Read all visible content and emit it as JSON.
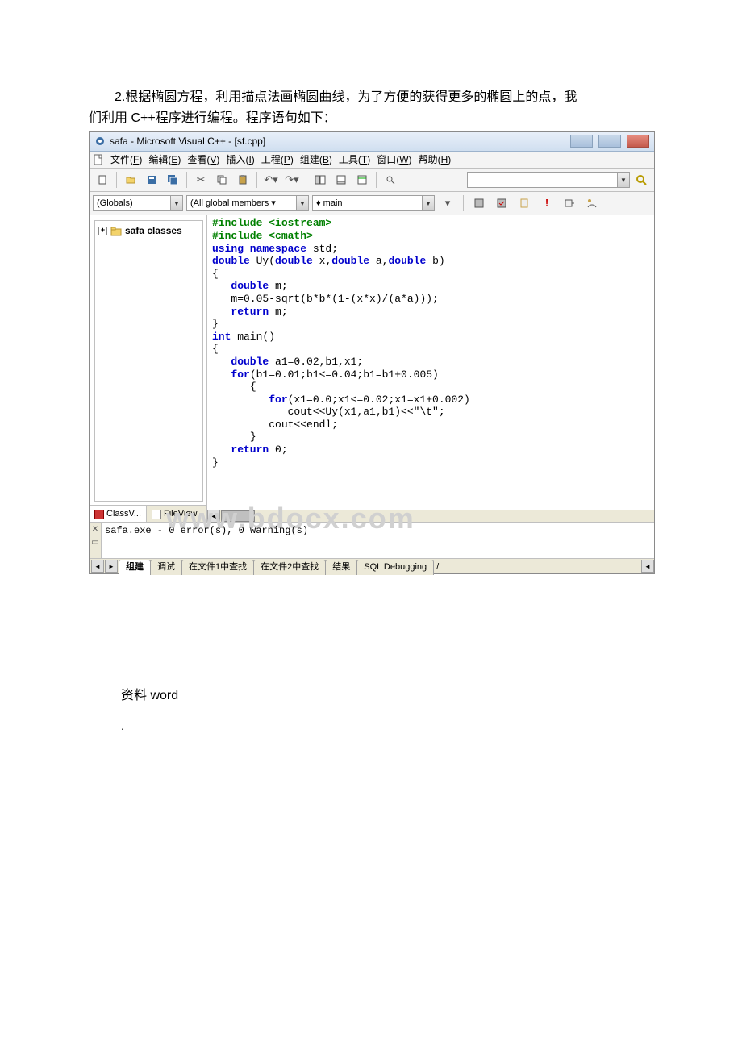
{
  "doc": {
    "intro1": "2.根据椭圆方程，利用描点法画椭圆曲线，为了方便的获得更多的椭圆上的点，我",
    "intro2": "们利用 C++程序进行编程。程序语句如下：",
    "footer1": "资料 word",
    "footer_dot": "."
  },
  "ide": {
    "title": "safa - Microsoft Visual C++ - [sf.cpp]",
    "menu": {
      "file": {
        "label": "文件",
        "accel": "F"
      },
      "edit": {
        "label": "编辑",
        "accel": "E"
      },
      "view": {
        "label": "查看",
        "accel": "V"
      },
      "insert": {
        "label": "插入",
        "accel": "I"
      },
      "project": {
        "label": "工程",
        "accel": "P"
      },
      "build": {
        "label": "组建",
        "accel": "B"
      },
      "tools": {
        "label": "工具",
        "accel": "T"
      },
      "window": {
        "label": "窗口",
        "accel": "W"
      },
      "help": {
        "label": "帮助",
        "accel": "H"
      }
    },
    "combos": {
      "scope": "(Globals)",
      "members": "(All global members ▾",
      "func": "♦ main",
      "config": ""
    },
    "tree": {
      "root": "safa classes"
    },
    "side_tabs": {
      "classv": "ClassV...",
      "filev": "FileView"
    },
    "code": [
      {
        "pre": "#include <iostream>"
      },
      {
        "pre": "#include <cmath>"
      },
      {
        "kw": "using namespace",
        "tail": " std;"
      },
      {
        "kw": "double",
        "tail": " Uy(",
        "kw2": "double",
        "tail2": " x,",
        "kw3": "double",
        "tail3": " a,",
        "kw4": "double",
        "tail4": " b)"
      },
      {
        "plain": "{"
      },
      {
        "indent": 1,
        "kw": "double",
        "tail": " m;"
      },
      {
        "indent": 1,
        "plain": "m=0.05-sqrt(b*b*(1-(x*x)/(a*a)));"
      },
      {
        "indent": 1,
        "kw": "return",
        "tail": " m;"
      },
      {
        "plain": "}"
      },
      {
        "kw": "int",
        "tail": " main()"
      },
      {
        "plain": "{"
      },
      {
        "indent": 1,
        "kw": "double",
        "tail": " a1=0.02,b1,x1;"
      },
      {
        "indent": 1,
        "kw": "for",
        "tail": "(b1=0.01;b1<=0.04;b1=b1+0.005)"
      },
      {
        "indent": 2,
        "plain": "{"
      },
      {
        "indent": 3,
        "kw": "for",
        "tail": "(x1=0.0;x1<=0.02;x1=x1+0.002)"
      },
      {
        "indent": 4,
        "plain": "cout<<Uy(x1,a1,b1)<<\"\\t\";"
      },
      {
        "indent": 3,
        "plain": "cout<<endl;"
      },
      {
        "indent": 2,
        "plain": "}"
      },
      {
        "indent": 1,
        "kw": "return",
        "tail": " 0;"
      },
      {
        "plain": "}"
      }
    ],
    "output": "safa.exe - 0 error(s), 0 warning(s)",
    "bottom_tabs": {
      "build": "组建",
      "debug": "调试",
      "find1": "在文件1中查找",
      "find2": "在文件2中查找",
      "result": "结果",
      "sql": "SQL Debugging"
    },
    "watermark": "www.bdocx.com"
  }
}
